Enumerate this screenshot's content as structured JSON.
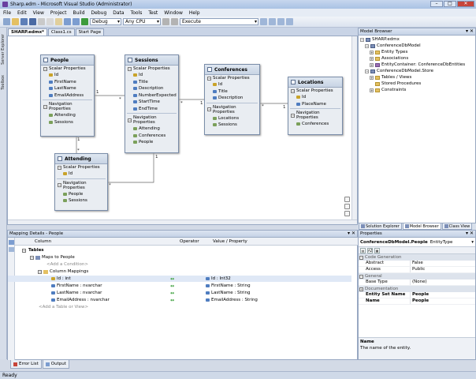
{
  "window": {
    "title": "Sharp.edm - Microsoft Visual Studio (Administrator)"
  },
  "menu": [
    "File",
    "Edit",
    "View",
    "Project",
    "Build",
    "Debug",
    "Data",
    "Tools",
    "Test",
    "Window",
    "Help"
  ],
  "toolbar": {
    "config": "Debug",
    "platform": "Any CPU",
    "execute_label": "Execute"
  },
  "left_strip": [
    "Server Explorer",
    "Toolbox"
  ],
  "doc_tabs": [
    "SHARP.edmx*",
    "Class1.cs",
    "Start Page"
  ],
  "entities": {
    "people": {
      "name": "People",
      "scalar_header": "Scalar Properties",
      "scalar": [
        "Id",
        "FirstName",
        "LastName",
        "EmailAddress"
      ],
      "nav_header": "Navigation Properties",
      "nav": [
        "Attending",
        "Sessions"
      ]
    },
    "sessions": {
      "name": "Sessions",
      "scalar_header": "Scalar Properties",
      "scalar": [
        "Id",
        "Title",
        "Description",
        "NumberExpected",
        "StartTime",
        "EndTime"
      ],
      "nav_header": "Navigation Properties",
      "nav": [
        "Attending",
        "Conferences",
        "People"
      ]
    },
    "conferences": {
      "name": "Conferences",
      "scalar_header": "Scalar Properties",
      "scalar": [
        "Id",
        "Title",
        "Description"
      ],
      "nav_header": "Navigation Properties",
      "nav": [
        "Locations",
        "Sessions"
      ]
    },
    "locations": {
      "name": "Locations",
      "scalar_header": "Scalar Properties",
      "scalar": [
        "Id",
        "PlaceName"
      ],
      "nav_header": "Navigation Properties",
      "nav": [
        "Conferences"
      ]
    },
    "attending": {
      "name": "Attending",
      "scalar_header": "Scalar Properties",
      "scalar": [
        "Id"
      ],
      "nav_header": "Navigation Properties",
      "nav": [
        "People",
        "Sessions"
      ]
    }
  },
  "multiplicities": {
    "one": "1",
    "many": "*"
  },
  "model_browser": {
    "title": "Model Browser",
    "tree": [
      {
        "label": "SHARP.edmx",
        "level": 0,
        "icon": "model"
      },
      {
        "label": "ConferenceDbModel",
        "level": 1,
        "icon": "model"
      },
      {
        "label": "Entity Types",
        "level": 2,
        "icon": "folder"
      },
      {
        "label": "Associations",
        "level": 2,
        "icon": "folder"
      },
      {
        "label": "EntityContainer: ConferenceDbEntities",
        "level": 2,
        "icon": "cont"
      },
      {
        "label": "ConferenceDbModel.Store",
        "level": 1,
        "icon": "model"
      },
      {
        "label": "Tables / Views",
        "level": 2,
        "icon": "folder"
      },
      {
        "label": "Stored Procedures",
        "level": 2,
        "icon": "folder"
      },
      {
        "label": "Constraints",
        "level": 2,
        "icon": "folder"
      }
    ],
    "tabs": [
      "Solution Explorer",
      "Model Browser",
      "Class View"
    ]
  },
  "mapping": {
    "title": "Mapping Details - People",
    "col_column": "Column",
    "col_operator": "Operator",
    "col_value": "Value / Property",
    "tables": "Tables",
    "maps_to": "Maps to People",
    "add_condition": "<Add a Condition>",
    "column_mappings": "Column Mappings",
    "rows": [
      {
        "column": "Id : int",
        "op": "↔",
        "value": "Id : Int32"
      },
      {
        "column": "FirstName : nvarchar",
        "op": "↔",
        "value": "FirstName : String"
      },
      {
        "column": "LastName : nvarchar",
        "op": "↔",
        "value": "LastName : String"
      },
      {
        "column": "EmailAddress : nvarchar",
        "op": "↔",
        "value": "EmailAddress : String"
      }
    ],
    "add_table": "<Add a Table or View>"
  },
  "properties": {
    "title": "Properties",
    "object_name": "ConferenceDbModel.People",
    "object_type": "EntityType",
    "categories": [
      {
        "name": "Code Generation",
        "rows": [
          {
            "k": "Abstract",
            "v": "False"
          },
          {
            "k": "Access",
            "v": "Public"
          }
        ]
      },
      {
        "name": "General",
        "rows": [
          {
            "k": "Base Type",
            "v": "(None)"
          }
        ]
      },
      {
        "name": "Documentation",
        "rows": [
          {
            "k": "Entity Set Name",
            "v": "People"
          },
          {
            "k": "Name",
            "v": "People"
          }
        ]
      }
    ],
    "desc_title": "Name",
    "desc_text": "The name of the entity."
  },
  "bottom_tabs": [
    "Error List",
    "Output"
  ],
  "status": "Ready"
}
